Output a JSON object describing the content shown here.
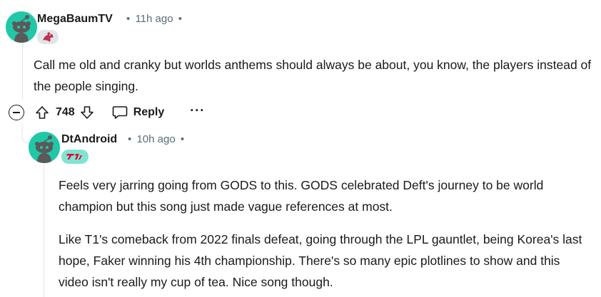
{
  "comment": {
    "username": "MegaBaumTV",
    "time": "11h ago",
    "flair_icon": "dragon-flair-icon",
    "body": "Call me old and cranky but worlds anthems should always be about, you know, the players instead of the people singing.",
    "score": "748",
    "reply_label": "Reply",
    "more_label": "···"
  },
  "reply": {
    "username": "DtAndroid",
    "time": "10h ago",
    "flair_icon": "t1-flair-icon",
    "paragraphs": [
      "Feels very jarring going from GODS to this. GODS celebrated Deft's journey to be world champion but this song just made vague references at most.",
      "Like T1's comeback from 2022 finals defeat, going through the LPL gauntlet, being Korea's last hope, Faker winning his 4th championship. There's so many epic plotlines to show and this video isn't really my cup of tea. Nice song though."
    ]
  },
  "colors": {
    "avatar": "#20c8a8",
    "meta": "#576f76",
    "t1_red": "#e2012d"
  },
  "dot": "•"
}
